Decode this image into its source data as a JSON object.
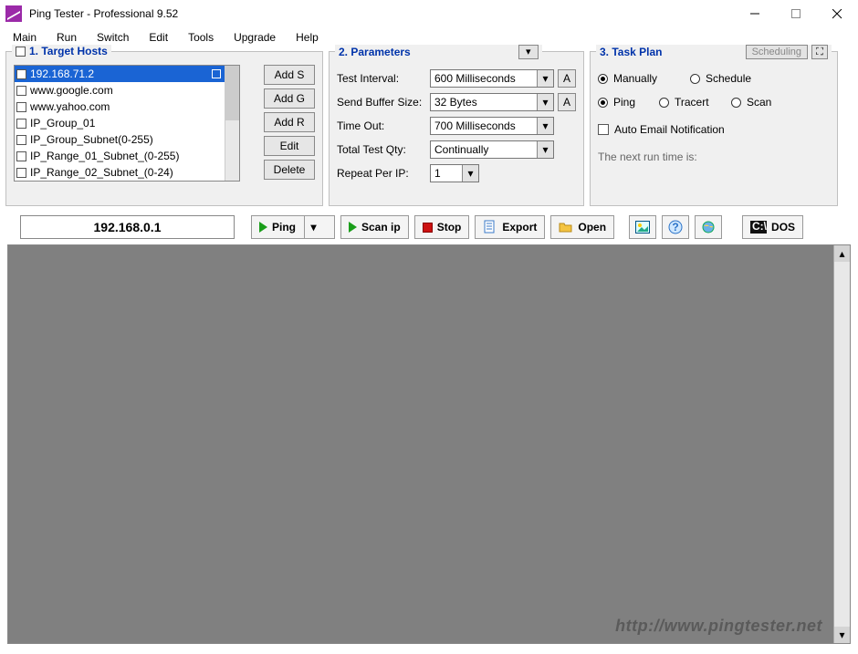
{
  "window": {
    "title": "Ping Tester - Professional  9.52"
  },
  "menu": {
    "items": [
      "Main",
      "Run",
      "Switch",
      "Edit",
      "Tools",
      "Upgrade",
      "Help"
    ]
  },
  "group1": {
    "title": "1. Target Hosts",
    "hosts": [
      "192.168.71.2",
      "www.google.com",
      "www.yahoo.com",
      "IP_Group_01",
      "IP_Group_Subnet(0-255)",
      "IP_Range_01_Subnet_(0-255)",
      "IP_Range_02_Subnet_(0-24)"
    ],
    "buttons": {
      "addS": "Add S",
      "addG": "Add G",
      "addR": "Add R",
      "edit": "Edit",
      "delete": "Delete"
    }
  },
  "group2": {
    "title": "2. Parameters",
    "rows": {
      "ti_label": "Test Interval:",
      "ti_value": "600  Milliseconds",
      "sb_label": "Send Buffer Size:",
      "sb_value": "32  Bytes",
      "to_label": "Time Out:",
      "to_value": "700  Milliseconds",
      "tt_label": "Total Test Qty:",
      "tt_value": "Continually",
      "rp_label": "Repeat Per IP:",
      "rp_value": "1"
    },
    "a_label": "A"
  },
  "group3": {
    "title": "3. Task Plan",
    "scheduling": "Scheduling",
    "manually": "Manually",
    "schedule": "Schedule",
    "ping": "Ping",
    "tracert": "Tracert",
    "scan": "Scan",
    "autoemail": "Auto Email Notification",
    "nextrun": "The next run time is:"
  },
  "toolbar": {
    "ip": "192.168.0.1",
    "ping": "Ping",
    "scanip": "Scan ip",
    "stop": "Stop",
    "export": "Export",
    "open": "Open",
    "dos": "DOS"
  },
  "watermark": "http://www.pingtester.net"
}
